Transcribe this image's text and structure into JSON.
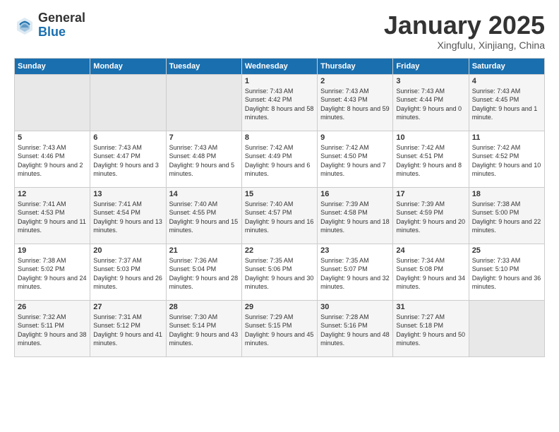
{
  "header": {
    "logo_general": "General",
    "logo_blue": "Blue",
    "title": "January 2025",
    "location": "Xingfulu, Xinjiang, China"
  },
  "weekdays": [
    "Sunday",
    "Monday",
    "Tuesday",
    "Wednesday",
    "Thursday",
    "Friday",
    "Saturday"
  ],
  "weeks": [
    [
      {
        "day": "",
        "info": ""
      },
      {
        "day": "",
        "info": ""
      },
      {
        "day": "",
        "info": ""
      },
      {
        "day": "1",
        "info": "Sunrise: 7:43 AM\nSunset: 4:42 PM\nDaylight: 8 hours and 58 minutes."
      },
      {
        "day": "2",
        "info": "Sunrise: 7:43 AM\nSunset: 4:43 PM\nDaylight: 8 hours and 59 minutes."
      },
      {
        "day": "3",
        "info": "Sunrise: 7:43 AM\nSunset: 4:44 PM\nDaylight: 9 hours and 0 minutes."
      },
      {
        "day": "4",
        "info": "Sunrise: 7:43 AM\nSunset: 4:45 PM\nDaylight: 9 hours and 1 minute."
      }
    ],
    [
      {
        "day": "5",
        "info": "Sunrise: 7:43 AM\nSunset: 4:46 PM\nDaylight: 9 hours and 2 minutes."
      },
      {
        "day": "6",
        "info": "Sunrise: 7:43 AM\nSunset: 4:47 PM\nDaylight: 9 hours and 3 minutes."
      },
      {
        "day": "7",
        "info": "Sunrise: 7:43 AM\nSunset: 4:48 PM\nDaylight: 9 hours and 5 minutes."
      },
      {
        "day": "8",
        "info": "Sunrise: 7:42 AM\nSunset: 4:49 PM\nDaylight: 9 hours and 6 minutes."
      },
      {
        "day": "9",
        "info": "Sunrise: 7:42 AM\nSunset: 4:50 PM\nDaylight: 9 hours and 7 minutes."
      },
      {
        "day": "10",
        "info": "Sunrise: 7:42 AM\nSunset: 4:51 PM\nDaylight: 9 hours and 8 minutes."
      },
      {
        "day": "11",
        "info": "Sunrise: 7:42 AM\nSunset: 4:52 PM\nDaylight: 9 hours and 10 minutes."
      }
    ],
    [
      {
        "day": "12",
        "info": "Sunrise: 7:41 AM\nSunset: 4:53 PM\nDaylight: 9 hours and 11 minutes."
      },
      {
        "day": "13",
        "info": "Sunrise: 7:41 AM\nSunset: 4:54 PM\nDaylight: 9 hours and 13 minutes."
      },
      {
        "day": "14",
        "info": "Sunrise: 7:40 AM\nSunset: 4:55 PM\nDaylight: 9 hours and 15 minutes."
      },
      {
        "day": "15",
        "info": "Sunrise: 7:40 AM\nSunset: 4:57 PM\nDaylight: 9 hours and 16 minutes."
      },
      {
        "day": "16",
        "info": "Sunrise: 7:39 AM\nSunset: 4:58 PM\nDaylight: 9 hours and 18 minutes."
      },
      {
        "day": "17",
        "info": "Sunrise: 7:39 AM\nSunset: 4:59 PM\nDaylight: 9 hours and 20 minutes."
      },
      {
        "day": "18",
        "info": "Sunrise: 7:38 AM\nSunset: 5:00 PM\nDaylight: 9 hours and 22 minutes."
      }
    ],
    [
      {
        "day": "19",
        "info": "Sunrise: 7:38 AM\nSunset: 5:02 PM\nDaylight: 9 hours and 24 minutes."
      },
      {
        "day": "20",
        "info": "Sunrise: 7:37 AM\nSunset: 5:03 PM\nDaylight: 9 hours and 26 minutes."
      },
      {
        "day": "21",
        "info": "Sunrise: 7:36 AM\nSunset: 5:04 PM\nDaylight: 9 hours and 28 minutes."
      },
      {
        "day": "22",
        "info": "Sunrise: 7:35 AM\nSunset: 5:06 PM\nDaylight: 9 hours and 30 minutes."
      },
      {
        "day": "23",
        "info": "Sunrise: 7:35 AM\nSunset: 5:07 PM\nDaylight: 9 hours and 32 minutes."
      },
      {
        "day": "24",
        "info": "Sunrise: 7:34 AM\nSunset: 5:08 PM\nDaylight: 9 hours and 34 minutes."
      },
      {
        "day": "25",
        "info": "Sunrise: 7:33 AM\nSunset: 5:10 PM\nDaylight: 9 hours and 36 minutes."
      }
    ],
    [
      {
        "day": "26",
        "info": "Sunrise: 7:32 AM\nSunset: 5:11 PM\nDaylight: 9 hours and 38 minutes."
      },
      {
        "day": "27",
        "info": "Sunrise: 7:31 AM\nSunset: 5:12 PM\nDaylight: 9 hours and 41 minutes."
      },
      {
        "day": "28",
        "info": "Sunrise: 7:30 AM\nSunset: 5:14 PM\nDaylight: 9 hours and 43 minutes."
      },
      {
        "day": "29",
        "info": "Sunrise: 7:29 AM\nSunset: 5:15 PM\nDaylight: 9 hours and 45 minutes."
      },
      {
        "day": "30",
        "info": "Sunrise: 7:28 AM\nSunset: 5:16 PM\nDaylight: 9 hours and 48 minutes."
      },
      {
        "day": "31",
        "info": "Sunrise: 7:27 AM\nSunset: 5:18 PM\nDaylight: 9 hours and 50 minutes."
      },
      {
        "day": "",
        "info": ""
      }
    ]
  ]
}
